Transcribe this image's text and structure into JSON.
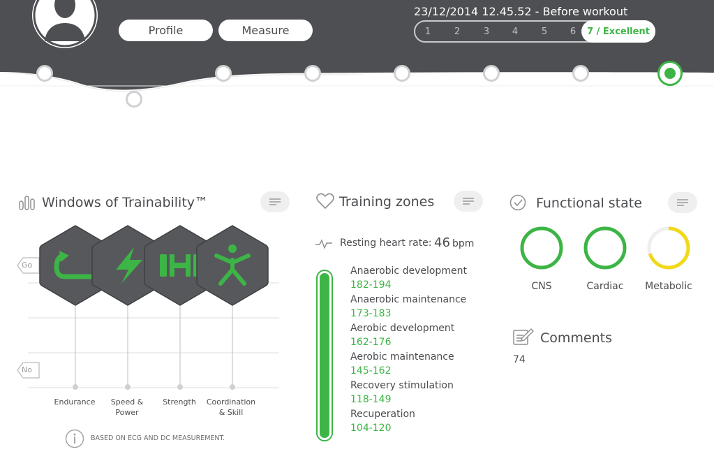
{
  "header": {
    "profile_label": "Profile",
    "measure_label": "Measure",
    "measurement_info": "23/12/2014 12.45.52 - Before workout",
    "scale": {
      "numbers": [
        "1",
        "2",
        "3",
        "4",
        "5",
        "6"
      ],
      "selected_label": "7 / Excellent",
      "selected_value": 7,
      "max_value": 7
    },
    "timeline": {
      "node_count": 8,
      "active_index": 7
    }
  },
  "windows_of_trainability": {
    "title": "Windows of Trainability™",
    "go_label": "Go",
    "no_label": "No",
    "items": [
      {
        "label_line1": "Endurance",
        "label_line2": "",
        "icon": "endurance-refresh-icon"
      },
      {
        "label_line1": "Speed &",
        "label_line2": "Power",
        "icon": "lightning-icon"
      },
      {
        "label_line1": "Strength",
        "label_line2": "",
        "icon": "dumbbell-icon"
      },
      {
        "label_line1": "Coordination",
        "label_line2": "& Skill",
        "icon": "figure-icon"
      }
    ],
    "footnote": "BASED ON ECG AND DC MEASUREMENT."
  },
  "training_zones": {
    "title": "Training zones",
    "resting_hr_label": "Resting heart rate:",
    "resting_hr_value": "46",
    "resting_hr_unit": "bpm",
    "zones": [
      {
        "name": "Anaerobic development",
        "range": "182-194"
      },
      {
        "name": "Anaerobic maintenance",
        "range": "173-183"
      },
      {
        "name": "Aerobic development",
        "range": "162-176"
      },
      {
        "name": "Aerobic maintenance",
        "range": "145-162"
      },
      {
        "name": "Recovery stimulation",
        "range": "118-149"
      },
      {
        "name": "Recuperation",
        "range": "104-120"
      }
    ]
  },
  "functional_state": {
    "title": "Functional state",
    "rings": [
      {
        "label": "CNS",
        "fraction": 1.0,
        "color": "#3db546"
      },
      {
        "label": "Cardiac",
        "fraction": 1.0,
        "color": "#3db546"
      },
      {
        "label": "Metabolic",
        "fraction": 0.7,
        "color": "#f2d81a"
      }
    ],
    "comments_title": "Comments",
    "comments_value": "74"
  },
  "colors": {
    "header_bg": "#4d4f52",
    "accent_green": "#3db546",
    "metabolic_yellow": "#f2d81a",
    "hex_fill": "#56585b"
  }
}
